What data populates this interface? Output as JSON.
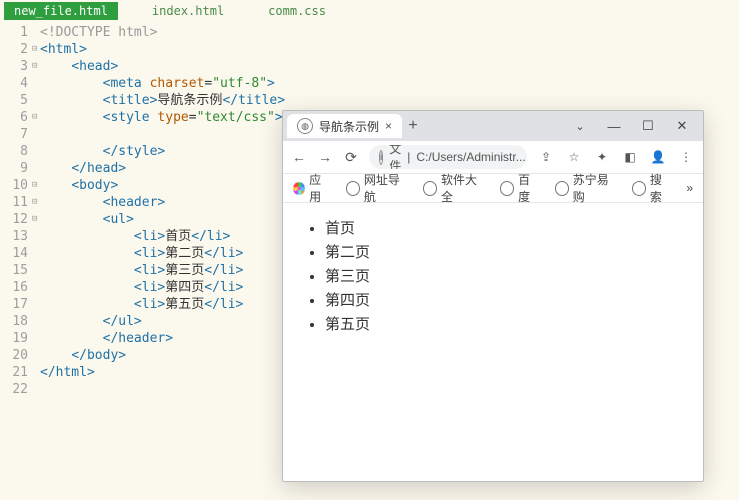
{
  "editor": {
    "tabs": [
      {
        "label": "new_file.html",
        "active": true
      },
      {
        "label": "index.html",
        "active": false
      },
      {
        "label": "comm.css",
        "active": false
      }
    ],
    "lines": {
      "n1": "1",
      "n2": "2",
      "n3": "3",
      "n4": "4",
      "n5": "5",
      "n6": "6",
      "n7": "7",
      "n8": "8",
      "n9": "9",
      "n10": "10",
      "n11": "11",
      "n12": "12",
      "n13": "13",
      "n14": "14",
      "n15": "15",
      "n16": "16",
      "n17": "17",
      "n18": "18",
      "n19": "19",
      "n20": "20",
      "n21": "21",
      "n22": "22"
    },
    "code": {
      "doctype": "<!DOCTYPE html>",
      "page_title": "导航条示例",
      "charset": "utf-8",
      "style_type": "text/css",
      "li1": "首页",
      "li2": "第二页",
      "li3": "第三页",
      "li4": "第四页",
      "li5": "第五页"
    }
  },
  "browser": {
    "tab_title": "导航条示例",
    "url_prefix": "文件",
    "url_path": "C:/Users/Administr...",
    "bookmarks": {
      "apps": "应用",
      "nav": "网址导航",
      "soft": "软件大全",
      "baidu": "百度",
      "suning": "苏宁易购",
      "search": "搜索"
    },
    "page_items": [
      "首页",
      "第二页",
      "第三页",
      "第四页",
      "第五页"
    ]
  }
}
